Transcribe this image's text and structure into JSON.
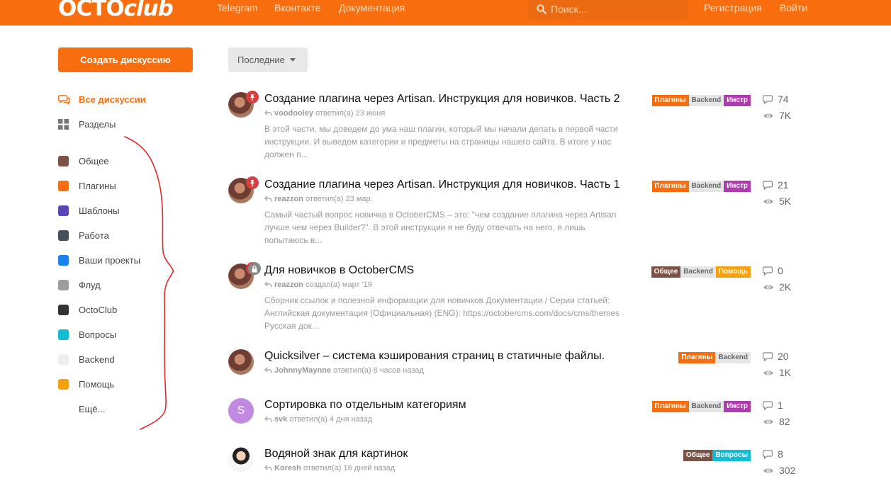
{
  "header": {
    "logo": "OCTOclub",
    "nav": [
      "Telegram",
      "Вконтакте",
      "Документация"
    ],
    "search": {
      "placeholder": "Поиск..."
    },
    "register": "Регистрация",
    "login": "Войти"
  },
  "sidebar": {
    "create_button": "Создать дискуссию",
    "all_discussions": "Все дискуссии",
    "sections": "Разделы",
    "categories": [
      {
        "label": "Общее",
        "color": "#7b5245"
      },
      {
        "label": "Плагины",
        "color": "#f86e0e"
      },
      {
        "label": "Шаблоны",
        "color": "#5a45b4"
      },
      {
        "label": "Работа",
        "color": "#45505f"
      },
      {
        "label": "Ваши проекты",
        "color": "#1a82f0"
      },
      {
        "label": "Флуд",
        "color": "#9e9e9e"
      },
      {
        "label": "OctoClub",
        "color": "#333333"
      },
      {
        "label": "Вопросы",
        "color": "#12bcd4"
      },
      {
        "label": "Backend",
        "color": "#eeeeee"
      },
      {
        "label": "Помощь",
        "color": "#f6a010"
      }
    ],
    "more": "Ещё..."
  },
  "sort": {
    "label": "Последние"
  },
  "discussions": [
    {
      "title": "Создание плагина через Artisan. Инструкция для новичков. Часть 2",
      "user": "voodooley",
      "action": "ответил(а)",
      "time": "23 июня",
      "excerpt": "В этой части, мы доведем до ума наш плагин, который мы начали делать в первой части инструкции. И выведем категории и предметы на страницы нашего сайта. В итоге у нас должен п...",
      "tags": [
        "Плагины",
        "Backend",
        "Инстр"
      ],
      "replies": "74",
      "views": "7K"
    },
    {
      "title": "Создание плагина через Artisan. Инструкция для новичков. Часть 1",
      "user": "reazzon",
      "action": "ответил(а)",
      "time": "23 мар.",
      "excerpt": "Самый частый вопрос новичка в OctoberCMS – это: \"чем создание плагина через Artisan лучше чем через Builder?\". В этой инструкции я не буду отвечать на него, я лишь попытаюсь в...",
      "tags": [
        "Плагины",
        "Backend",
        "Инстр"
      ],
      "replies": "21",
      "views": "5K"
    },
    {
      "title": "Для новичков в OctoberCMS",
      "user": "reazzon",
      "action": "создал(а)",
      "time": "март '19",
      "excerpt": "Сборник ссылок и полезной информации для новичков Документации / Серии статьей: Английская документация (Официальная) (ENG): https://octobercms.com/docs/cms/themes Русская док...",
      "tags": [
        "Общее",
        "Backend",
        "Помощь"
      ],
      "replies": "0",
      "views": "2K"
    },
    {
      "title": "Quicksilver – система кэширования страниц в статичные файлы.",
      "user": "JohnnyMaynne",
      "action": "ответил(а)",
      "time": "8 часов назад",
      "excerpt": "",
      "tags": [
        "Плагины",
        "Backend"
      ],
      "replies": "20",
      "views": "1K"
    },
    {
      "title": "Сортировка по отдельным категориям",
      "user": "svk",
      "action": "ответил(а)",
      "time": "4 дня назад",
      "excerpt": "",
      "tags": [
        "Плагины",
        "Backend",
        "Инстр"
      ],
      "replies": "1",
      "views": "82",
      "avatar_letter": "S"
    },
    {
      "title": "Водяной знак для картинок",
      "user": "Koresh",
      "action": "ответил(а)",
      "time": "16 дней назад",
      "excerpt": "",
      "tags": [
        "Общее",
        "Вопросы"
      ],
      "replies": "8",
      "views": "302"
    }
  ],
  "tag_colors": {
    "Плагины": "#f86e0e",
    "Backend": "#e6e6e6",
    "Инстр": "#b03ab0",
    "Общее": "#7b5245",
    "Помощь": "#f6a010",
    "Вопросы": "#12bcd4"
  }
}
